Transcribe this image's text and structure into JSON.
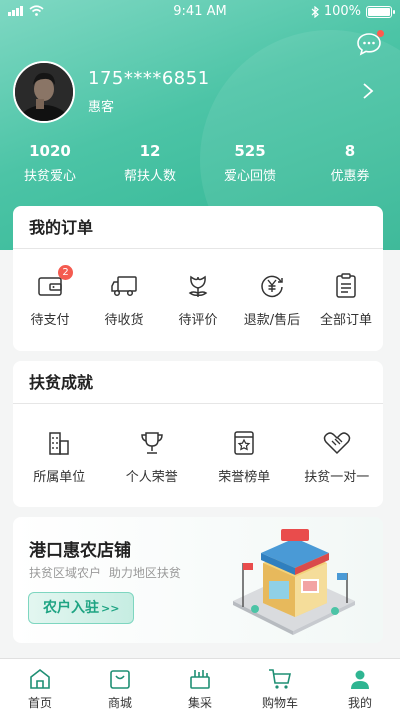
{
  "status_bar": {
    "time": "9:41 AM",
    "battery": "100%"
  },
  "profile": {
    "phone": "175****6851",
    "member_type": "惠客",
    "stats": [
      {
        "value": "1020",
        "label": "扶贫爱心"
      },
      {
        "value": "12",
        "label": "帮扶人数"
      },
      {
        "value": "525",
        "label": "爱心回馈"
      },
      {
        "value": "8",
        "label": "优惠券"
      }
    ]
  },
  "orders": {
    "title": "我的订单",
    "items": [
      {
        "label": "待支付",
        "icon": "wallet-icon",
        "badge": "2"
      },
      {
        "label": "待收货",
        "icon": "truck-icon"
      },
      {
        "label": "待评价",
        "icon": "flower-icon"
      },
      {
        "label": "退款/售后",
        "icon": "yen-refund-icon"
      },
      {
        "label": "全部订单",
        "icon": "clipboard-icon"
      }
    ]
  },
  "achievements": {
    "title": "扶贫成就",
    "items": [
      {
        "label": "所属单位",
        "icon": "building-icon"
      },
      {
        "label": "个人荣誉",
        "icon": "trophy-icon"
      },
      {
        "label": "荣誉榜单",
        "icon": "honor-board-icon"
      },
      {
        "label": "扶贫一对一",
        "icon": "handshake-icon"
      }
    ]
  },
  "shop": {
    "title": "港口惠农店铺",
    "subtitle": "扶贫区域农户 助力地区扶贫",
    "button": "农户入驻",
    "button_arrows": ">>"
  },
  "tabbar": [
    {
      "label": "首页",
      "icon": "home-icon"
    },
    {
      "label": "商城",
      "icon": "bag-icon"
    },
    {
      "label": "集采",
      "icon": "basket-icon"
    },
    {
      "label": "购物车",
      "icon": "cart-icon"
    },
    {
      "label": "我的",
      "icon": "user-icon"
    }
  ],
  "colors": {
    "accent": "#2fb592",
    "badge": "#f45b50"
  }
}
